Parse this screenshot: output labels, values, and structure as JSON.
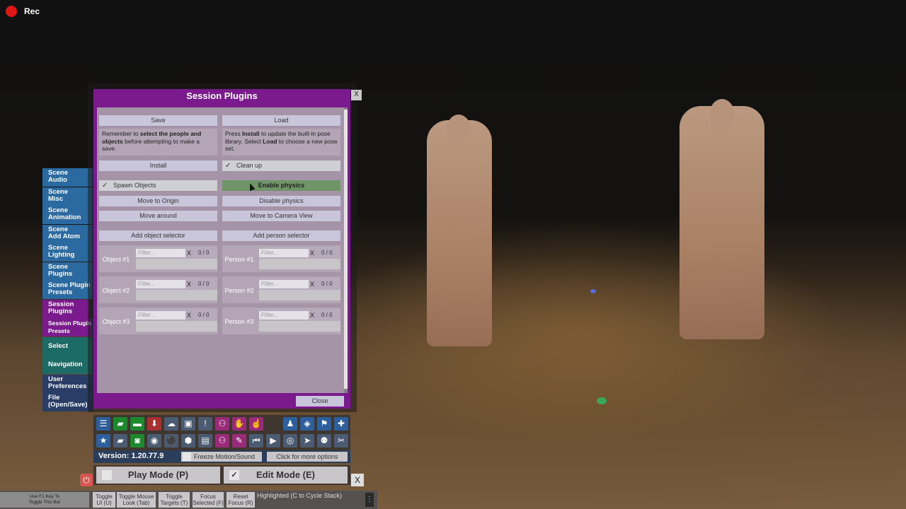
{
  "recording": {
    "label": "Rec"
  },
  "left_menu": [
    {
      "label": "Scene\nAudio"
    },
    {
      "label": "Scene\nMisc"
    },
    {
      "label": "Scene\nAnimation"
    },
    {
      "label": "Scene\nAdd Atom"
    },
    {
      "label": "Scene\nLighting"
    },
    {
      "label": "Scene\nPlugins"
    },
    {
      "label": "Scene Plugin\nPresets"
    },
    {
      "label": "Session\nPlugins"
    },
    {
      "label": "Session Plugin\nPresets"
    },
    {
      "label": "Select"
    },
    {
      "label": "Navigation"
    },
    {
      "label": "User\nPreferences"
    },
    {
      "label": "File\n(Open/Save)"
    }
  ],
  "window": {
    "title": "Session Plugins",
    "close_x": "X",
    "save_label": "Save",
    "load_label": "Load",
    "save_note_pre": "Remember to ",
    "save_note_bold1": "select the people and objects",
    "save_note_post": " before attempting to make a save.",
    "load_note_pre": "Press ",
    "load_note_bold1": "Install",
    "load_note_mid": " to update the built-in pose library. Select ",
    "load_note_bold2": "Load",
    "load_note_post": " to choose a new pose set.",
    "install_label": "Install",
    "cleanup_label": "Clean up",
    "spawn_objects_label": "Spawn Objects",
    "enable_physics_label": "Enable physics",
    "move_origin_label": "Move to Origin",
    "disable_physics_label": "Disable physics",
    "move_around_label": "Move around",
    "move_camera_label": "Move to Camera View",
    "add_object_selector_label": "Add object selector",
    "add_person_selector_label": "Add person selector",
    "filter_placeholder": "Filter...",
    "clear_x": "X",
    "count": "0 / 0",
    "objects": [
      {
        "label": "Object #1"
      },
      {
        "label": "Object #2"
      },
      {
        "label": "Object #3"
      }
    ],
    "persons": [
      {
        "label": "Person #1"
      },
      {
        "label": "Person #2"
      },
      {
        "label": "Person #3"
      }
    ],
    "close_label": "Close"
  },
  "toolbar": {
    "row1": [
      {
        "icon": "menu-icon",
        "glyph": "☰",
        "color": "blue"
      },
      {
        "icon": "open-folder-icon",
        "glyph": "▰",
        "color": "green"
      },
      {
        "icon": "folder-icon",
        "glyph": "▬",
        "color": "green"
      },
      {
        "icon": "save-icon",
        "glyph": "⬇",
        "color": "red"
      },
      {
        "icon": "cloud-icon",
        "glyph": "☁",
        "color": "grey"
      },
      {
        "icon": "package-icon",
        "glyph": "▣",
        "color": "grey"
      },
      {
        "icon": "info-icon",
        "glyph": "!",
        "color": "grey"
      },
      {
        "icon": "person-add-icon",
        "glyph": "⚇",
        "color": "magenta"
      },
      {
        "icon": "hand-icon",
        "glyph": "✋",
        "color": "magenta"
      },
      {
        "icon": "touch-icon",
        "glyph": "☝",
        "color": "magenta"
      },
      {
        "icon": "person-icon",
        "glyph": "♟",
        "color": "blue"
      },
      {
        "icon": "unity-icon",
        "glyph": "◈",
        "color": "blue"
      },
      {
        "icon": "flag-icon",
        "glyph": "⚑",
        "color": "blue"
      },
      {
        "icon": "plus-icon",
        "glyph": "✚",
        "color": "blue"
      }
    ],
    "row2": [
      {
        "icon": "star-icon",
        "glyph": "★",
        "color": "blue"
      },
      {
        "icon": "open-scene-icon",
        "glyph": "▰",
        "color": "grey"
      },
      {
        "icon": "screenshot-icon",
        "glyph": "◙",
        "color": "green"
      },
      {
        "icon": "camera-icon",
        "glyph": "◉",
        "color": "grey"
      },
      {
        "icon": "network-icon",
        "glyph": "⚫",
        "color": "grey"
      },
      {
        "icon": "box-icon",
        "glyph": "⬢",
        "color": "grey"
      },
      {
        "icon": "document-icon",
        "glyph": "▤",
        "color": "grey"
      },
      {
        "icon": "person-edit-icon",
        "glyph": "⚇",
        "color": "magenta"
      },
      {
        "icon": "wrench-icon",
        "glyph": "✎",
        "color": "magenta"
      },
      {
        "icon": "skip-start-icon",
        "glyph": "⏮",
        "color": "grey"
      },
      {
        "icon": "play-icon",
        "glyph": "▶",
        "color": "grey"
      },
      {
        "icon": "target-icon",
        "glyph": "◎",
        "color": "grey"
      },
      {
        "icon": "pointer-icon",
        "glyph": "➤",
        "color": "grey"
      },
      {
        "icon": "people-icon",
        "glyph": "⚉",
        "color": "grey"
      },
      {
        "icon": "tools-icon",
        "glyph": "✂",
        "color": "grey"
      }
    ]
  },
  "version": "Version: 1.20.77.9",
  "freeze_label": "Freeze Motion/Sound",
  "more_options_label": "Click for more options",
  "play_mode_label": "Play Mode (P)",
  "edit_mode_label": "Edit Mode (E)",
  "power_glyph": "⏻",
  "mode_close": "X",
  "hints": {
    "f1": "Use F1 Key To\nToggle This Bar",
    "buttons": [
      {
        "label": "Toggle\nUI (U)"
      },
      {
        "label": "Toggle Mouse\nLook (Tab)"
      },
      {
        "label": "Toggle\nTargets (T)"
      },
      {
        "label": "Focus\nSelected (F)"
      },
      {
        "label": "Reset\nFocus (R)"
      }
    ],
    "highlighted": "Highlighted (C to Cycle Stack)",
    "menu_glyph": "⋮"
  },
  "colors": {
    "panel": "#7a1a8c",
    "menu_blue": "#2a6aa0",
    "rec": "#e01515"
  }
}
